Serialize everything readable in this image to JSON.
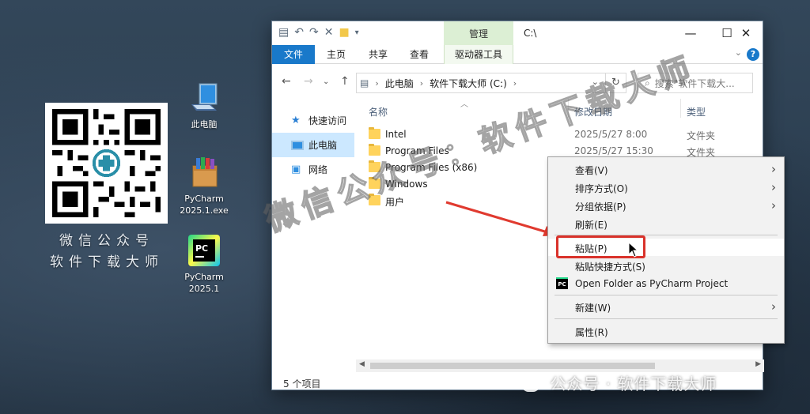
{
  "desktop": {
    "qr_caption_line1": "微信公众号",
    "qr_caption_line2": "软件下载大师",
    "icons": [
      {
        "label": "此电脑"
      },
      {
        "label": "PyCharm 2025.1.exe"
      },
      {
        "label": "PyCharm 2025.1"
      }
    ]
  },
  "window": {
    "title": "C:\\",
    "manage_tab": "管理",
    "ribbon_tabs": [
      "文件",
      "主页",
      "共享",
      "查看"
    ],
    "drive_tools_tab": "驱动器工具",
    "breadcrumb": [
      "此电脑",
      "软件下载大师 (C:)"
    ],
    "search_placeholder": "搜索\"软件下载大...",
    "sidebar": [
      "快速访问",
      "此电脑",
      "网络"
    ],
    "columns": {
      "name": "名称",
      "date": "修改日期",
      "type": "类型"
    },
    "files": [
      {
        "name": "Intel",
        "date": "2025/5/27 8:00",
        "type": "文件夹"
      },
      {
        "name": "Program Files",
        "date": "2025/5/27 15:30",
        "type": "文件夹"
      },
      {
        "name": "Program Files (x86)",
        "date": "",
        "type": ""
      },
      {
        "name": "Windows",
        "date": "",
        "type": ""
      },
      {
        "name": "用户",
        "date": "",
        "type": ""
      }
    ],
    "status": "5 个项目"
  },
  "context_menu": {
    "items": [
      {
        "label": "查看(V)",
        "submenu": true
      },
      {
        "label": "排序方式(O)",
        "submenu": true
      },
      {
        "label": "分组依据(P)",
        "submenu": true
      },
      {
        "label": "刷新(E)",
        "submenu": false
      },
      {
        "label": "粘贴(P)",
        "submenu": false
      },
      {
        "label": "粘贴快捷方式(S)",
        "submenu": false
      },
      {
        "label": "Open Folder as PyCharm Project",
        "submenu": false
      },
      {
        "label": "新建(W)",
        "submenu": true
      },
      {
        "label": "属性(R)",
        "submenu": false
      }
    ]
  },
  "watermarks": {
    "diagonal": "微信公众号：软件下载大师",
    "footer": "公众号 · 软件下载大师"
  },
  "colors": {
    "accent": "#1979ca",
    "highlight_box": "#d9322b",
    "manage_tab": "#dcefd4"
  }
}
